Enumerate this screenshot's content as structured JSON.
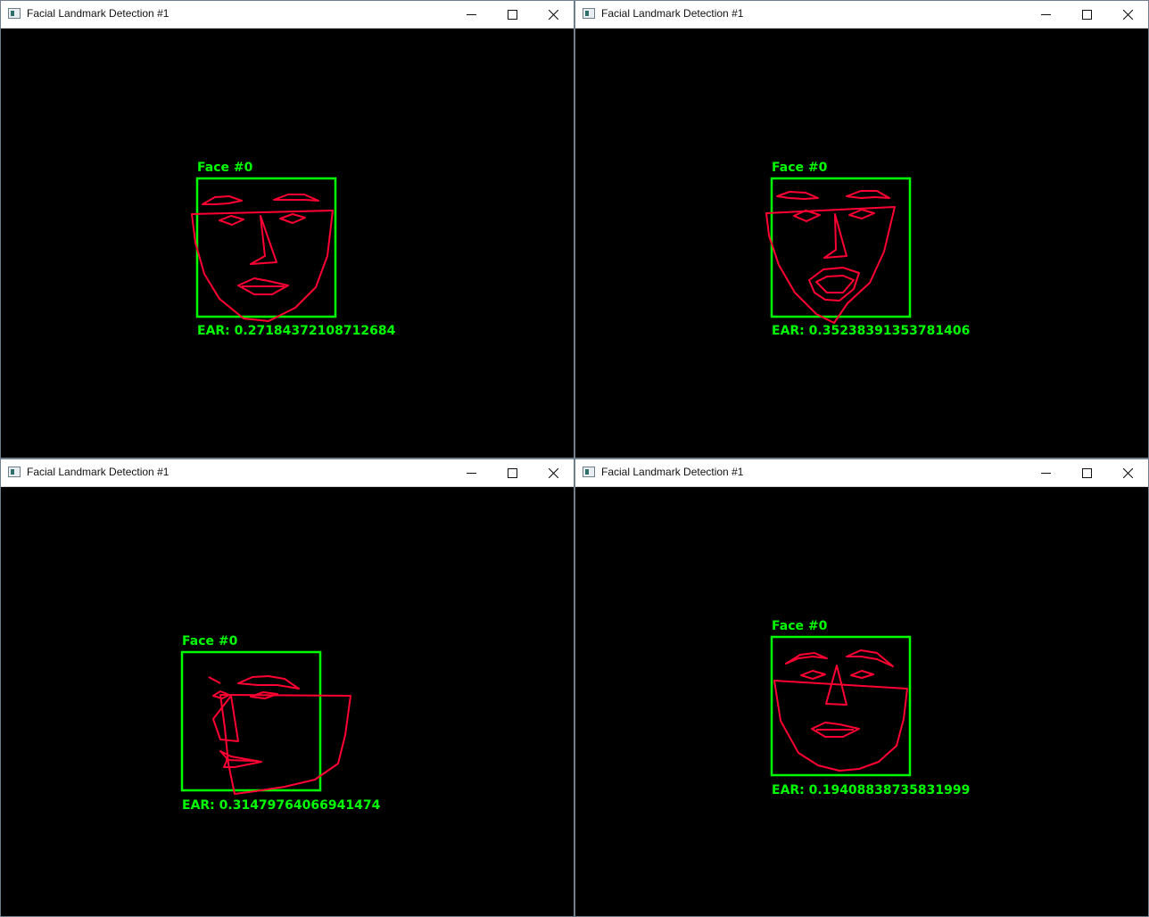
{
  "windows": [
    {
      "title": "Facial Landmark Detection #1",
      "face_label": "Face #0",
      "ear_label": "EAR: 0.27184372108712684"
    },
    {
      "title": "Facial Landmark Detection #1",
      "face_label": "Face #0",
      "ear_label": "EAR: 0.35238391353781406"
    },
    {
      "title": "Facial Landmark Detection #1",
      "face_label": "Face #0",
      "ear_label": "EAR: 0.31479764066941474"
    },
    {
      "title": "Facial Landmark Detection #1",
      "face_label": "Face #0",
      "ear_label": "EAR: 0.19408838735831999"
    }
  ],
  "colors": {
    "bounding_box": "#00ff00",
    "landmarks": "#ff0033",
    "labels": "#00ff00",
    "background": "#000000"
  },
  "icons": [
    "app-window-icon",
    "minimize-icon",
    "maximize-icon",
    "close-icon"
  ]
}
